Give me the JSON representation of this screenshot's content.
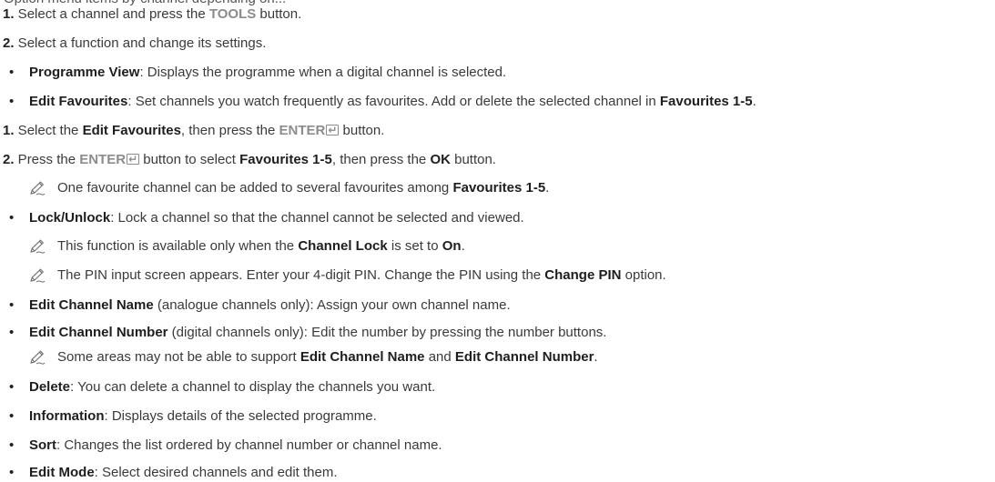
{
  "intro_cut": "Option menu items by channel depending on...",
  "steps_top": [
    {
      "num": "1.",
      "pre": " Select a channel and press the ",
      "key": "TOOLS",
      "post": " button."
    },
    {
      "num": "2.",
      "pre": " Select a function and change its settings.",
      "key": "",
      "post": ""
    }
  ],
  "programme_view": {
    "title": "Programme View",
    "desc": ": Displays the programme when a digital channel is selected."
  },
  "edit_favourites": {
    "title": "Edit Favourites",
    "desc": ": Set channels you watch frequently as favourites. Add or delete the selected channel in ",
    "fav": "Favourites 1-5",
    "end": "."
  },
  "fav_step1": {
    "num": "1.",
    "t1": " Select the ",
    "b1": "Edit Favourites",
    "t2": ", then press the ",
    "key": "ENTER",
    "t3": " button."
  },
  "fav_step2": {
    "num": "2.",
    "t1": " Press the ",
    "key": "ENTER",
    "t2": " button to select ",
    "b1": "Favourites 1-5",
    "t3": ", then press the ",
    "b2": "OK",
    "t4": " button."
  },
  "fav_note": {
    "t1": "One favourite channel can be added to several favourites among ",
    "b1": "Favourites 1-5",
    "t2": "."
  },
  "lock": {
    "title": "Lock/Unlock",
    "desc": ": Lock a channel so that the channel cannot be selected and viewed."
  },
  "lock_note1": {
    "t1": "This function is available only when the ",
    "b1": "Channel Lock",
    "t2": " is set to ",
    "b2": "On",
    "t3": "."
  },
  "lock_note2": {
    "t1": "The PIN input screen appears. Enter your 4-digit PIN. Change the PIN using the ",
    "b1": "Change PIN",
    "t2": " option."
  },
  "edit_name": {
    "title": "Edit Channel Name",
    "desc": " (analogue channels only): Assign your own channel name."
  },
  "edit_number": {
    "title": "Edit Channel Number",
    "desc": " (digital channels only): Edit the number by pressing the number buttons."
  },
  "edit_note": {
    "t1": "Some areas may not be able to support ",
    "b1": "Edit Channel Name",
    "t2": " and ",
    "b2": "Edit Channel Number",
    "t3": "."
  },
  "delete": {
    "title": "Delete",
    "desc": ": You can delete a channel to display the channels you want."
  },
  "information": {
    "title": "Information",
    "desc": ": Displays details of the selected programme."
  },
  "sort": {
    "title": "Sort",
    "desc": ": Changes the list ordered by channel number or channel name."
  },
  "edit_mode": {
    "title": "Edit Mode",
    "desc": ": Select desired channels and edit them."
  },
  "bullet_char": "•",
  "icons": {
    "note": "note-pencil-icon",
    "enter": "enter-key-icon"
  }
}
